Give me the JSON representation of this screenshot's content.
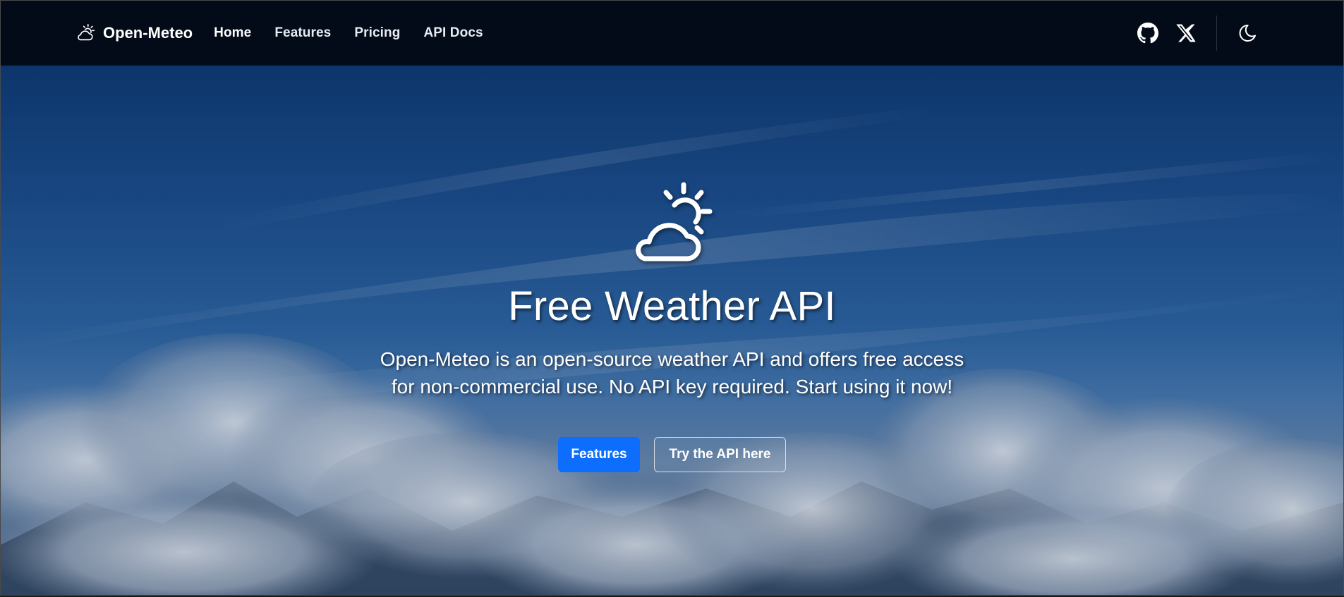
{
  "navbar": {
    "brand": "Open-Meteo",
    "links": [
      {
        "label": "Home",
        "active": true
      },
      {
        "label": "Features",
        "active": false
      },
      {
        "label": "Pricing",
        "active": false
      },
      {
        "label": "API Docs",
        "active": false
      }
    ],
    "icons": [
      "github-icon",
      "x-icon",
      "moon-icon"
    ]
  },
  "hero": {
    "icon": "cloud-sun-icon",
    "title": "Free Weather API",
    "lead_line1": "Open-Meteo is an open-source weather API and offers free access",
    "lead_line2": "for non-commercial use. No API key required. Start using it now!",
    "buttons": {
      "primary": "Features",
      "secondary": "Try the API here"
    }
  },
  "colors": {
    "navbar_bg": "#030a18",
    "primary": "#0d6efd",
    "text": "#ffffff"
  }
}
